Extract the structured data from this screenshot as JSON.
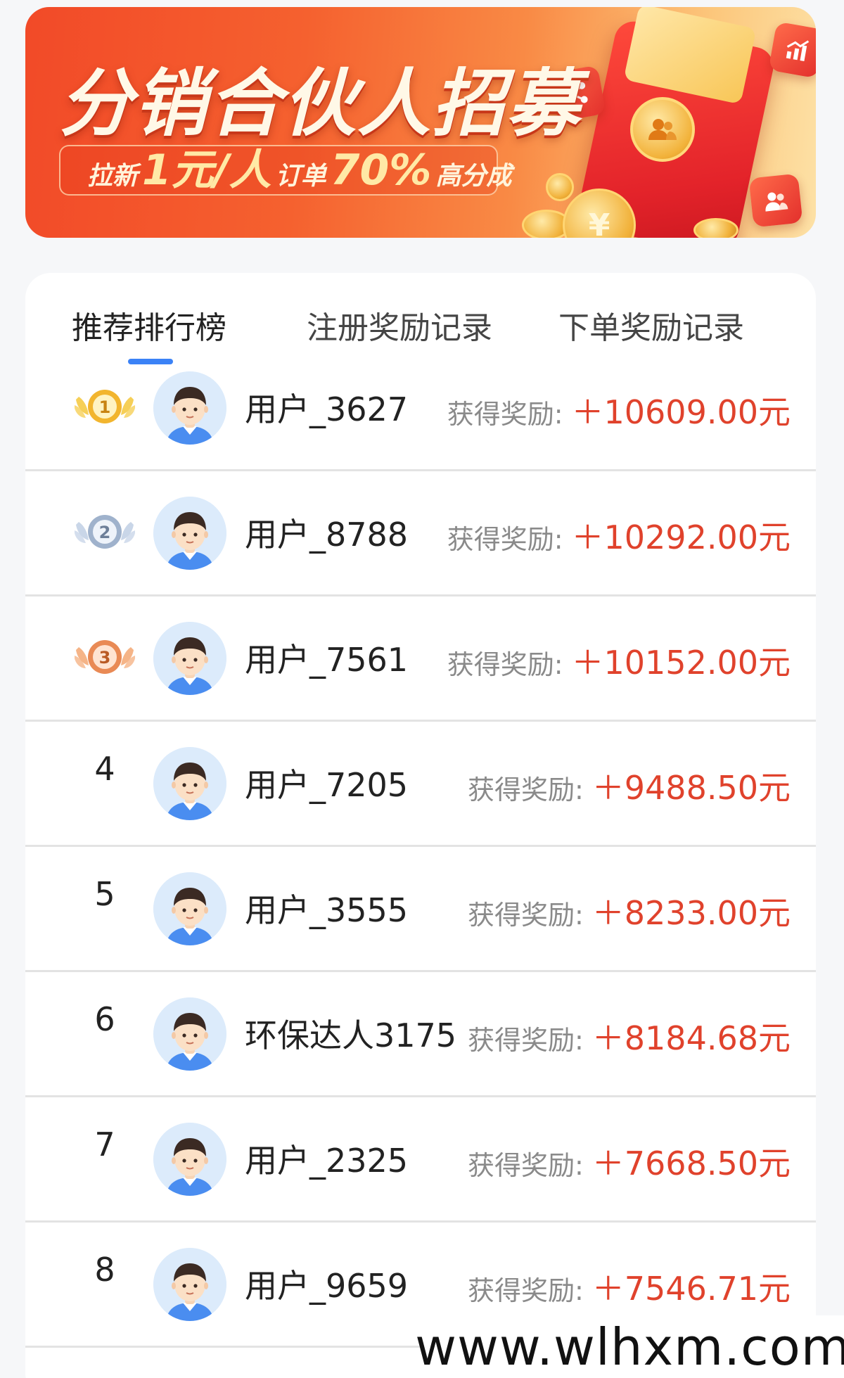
{
  "banner": {
    "title": "分销合伙人招募",
    "sub_prefix": "拉新",
    "sub_price": "1元/人",
    "sub_mid": "订单",
    "sub_percent": "70%",
    "sub_suffix": "高分成",
    "coin_symbol": "¥"
  },
  "tabs": [
    {
      "label": "推荐排行榜",
      "active": true
    },
    {
      "label": "注册奖励记录",
      "active": false
    },
    {
      "label": "下单奖励记录",
      "active": false
    }
  ],
  "ranking": {
    "reward_label": "获得奖励:",
    "rows": [
      {
        "rank": "1",
        "medal": "gold-medal-icon",
        "name": "用户_3627",
        "amount": "＋10609.00元"
      },
      {
        "rank": "2",
        "medal": "silver-medal-icon",
        "name": "用户_8788",
        "amount": "＋10292.00元"
      },
      {
        "rank": "3",
        "medal": "bronze-medal-icon",
        "name": "用户_7561",
        "amount": "＋10152.00元"
      },
      {
        "rank": "4",
        "name": "用户_7205",
        "amount": "＋9488.50元"
      },
      {
        "rank": "5",
        "name": "用户_3555",
        "amount": "＋8233.00元"
      },
      {
        "rank": "6",
        "name": "环保达人3175",
        "amount": "＋8184.68元"
      },
      {
        "rank": "7",
        "name": "用户_2325",
        "amount": "＋7668.50元"
      },
      {
        "rank": "8",
        "name": "用户_9659",
        "amount": "＋7546.71元"
      }
    ]
  },
  "watermark": "www.wlhxm.com",
  "colors": {
    "accent_red": "#e0422c",
    "tab_indicator": "#3b82f6",
    "banner_orange": "#f24a28"
  }
}
